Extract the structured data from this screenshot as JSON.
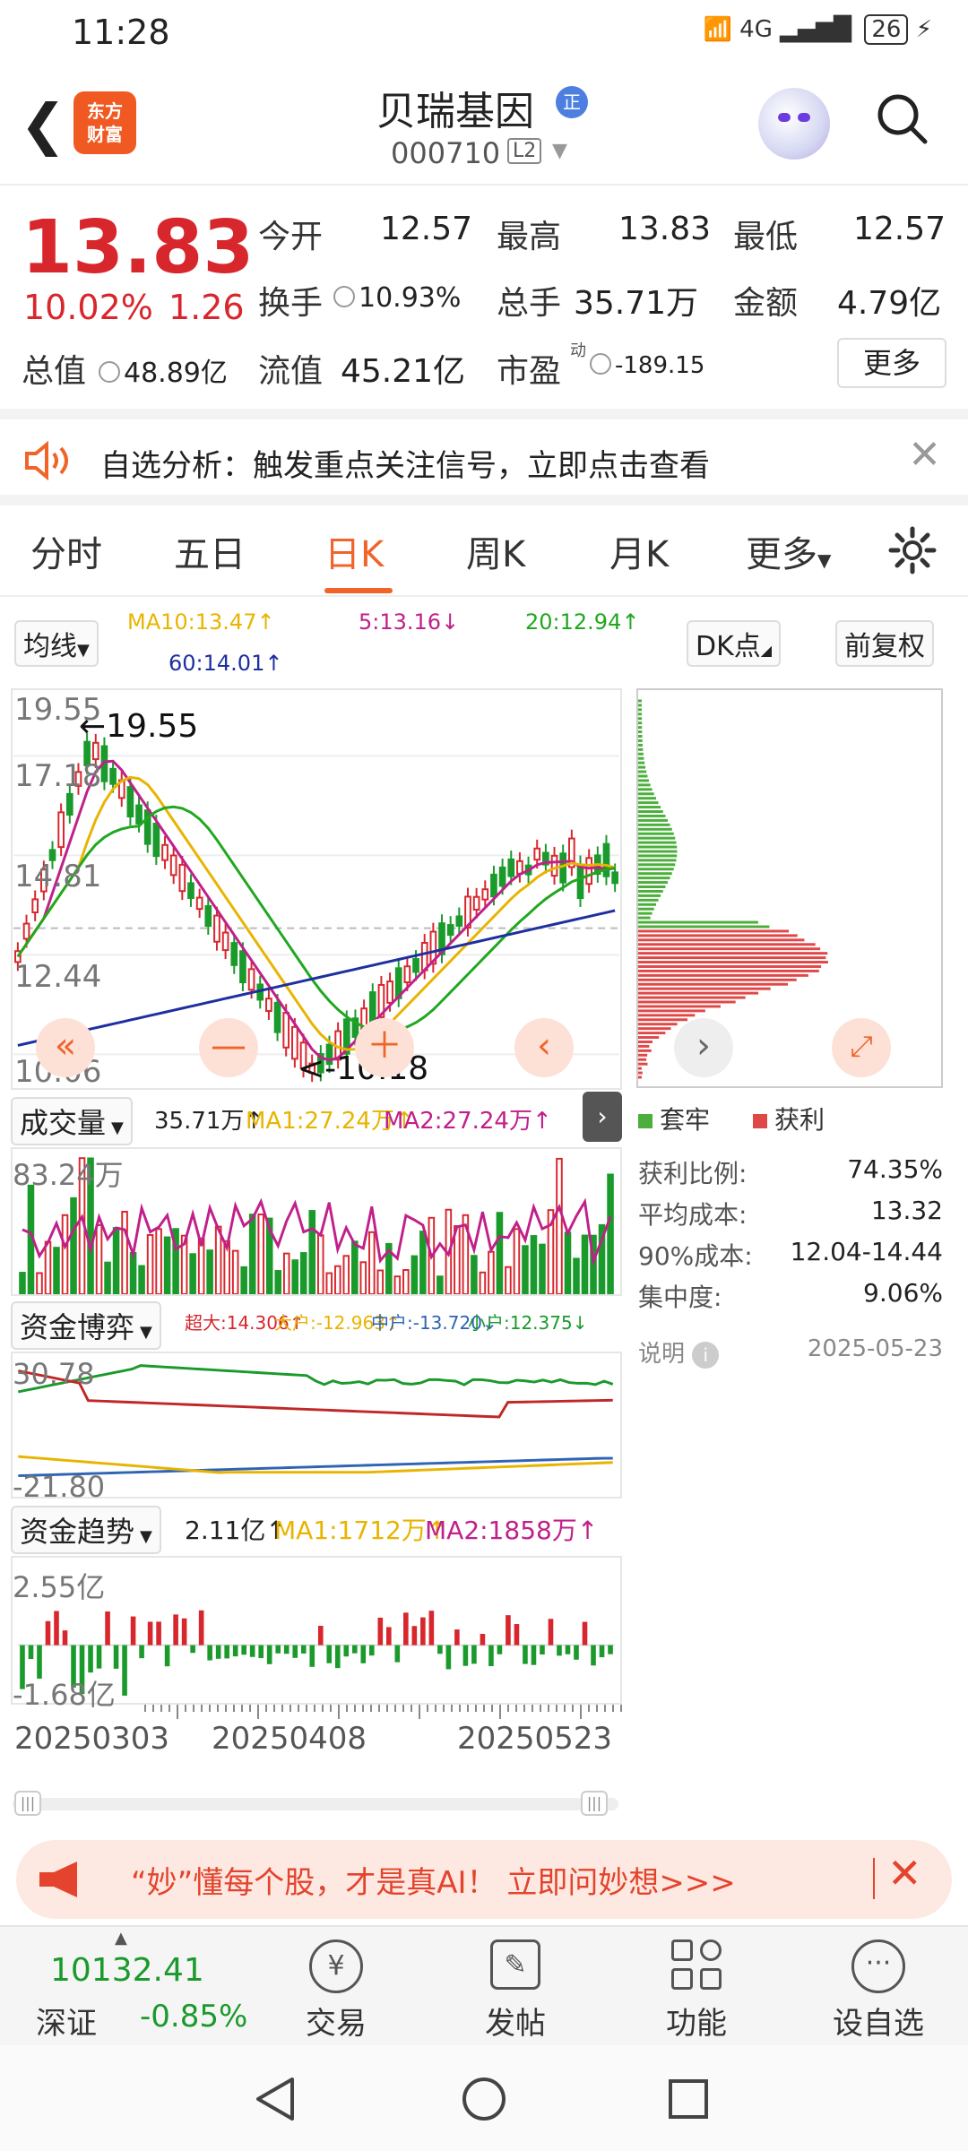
{
  "status_bar": {
    "time": "11:28",
    "network": "4G",
    "battery": "26"
  },
  "header": {
    "title": "贝瑞基因",
    "title_badge": "正",
    "code": "000710",
    "level": "L2",
    "logo_line1": "东方",
    "logo_line2": "财富"
  },
  "quote": {
    "price": "13.83",
    "change_pct": "10.02%",
    "change": "1.26",
    "open_label": "今开",
    "open": "12.57",
    "high_label": "最高",
    "high": "13.83",
    "low_label": "最低",
    "low": "12.57",
    "turnover_label": "换手",
    "turnover": "10.93%",
    "volume_label": "总手",
    "volume": "35.71万",
    "amount_label": "金额",
    "amount": "4.79亿",
    "mktcap_label": "总值",
    "mktcap": "48.89亿",
    "float_label": "流值",
    "float": "45.21亿",
    "pe_label": "市盈",
    "pe_sup": "动",
    "pe": "-189.15",
    "more_label": "更多"
  },
  "notice": {
    "text": "自选分析：触发重点关注信号，立即点击查看"
  },
  "tabs": [
    {
      "label": "分时"
    },
    {
      "label": "五日"
    },
    {
      "label": "日K"
    },
    {
      "label": "周K"
    },
    {
      "label": "月K"
    },
    {
      "label": "更多"
    }
  ],
  "kline": {
    "ma_selector": "均线",
    "ma10": "MA10:13.47↑",
    "ma5": "5:13.16↓",
    "ma20": "20:12.94↑",
    "ma60": "60:14.01↑",
    "dk_label": "DK点",
    "fq_label": "前复权",
    "y_ticks": [
      "19.55",
      "17.18",
      "14.81",
      "12.44",
      "10.06"
    ],
    "max_mark": "←19.55",
    "min_mark": "<-10.18"
  },
  "colors": {
    "accent": "#f0642a",
    "up": "#d8262d",
    "down": "#1b9a2c",
    "ma5": "#c0208a",
    "ma10": "#e8b400",
    "ma20": "#1fa81f",
    "ma60": "#1e2fa0"
  },
  "volume": {
    "selector": "成交量",
    "value": "35.71万↑",
    "ma1": "MA1:27.24万↑",
    "ma2": "MA2:27.24万↑",
    "y_top": "83.24万"
  },
  "fund_game": {
    "selector": "资金博弈",
    "super": "超大:14.306↑",
    "big": "大户:-12.963↑",
    "mid": "中户:-13.720↓",
    "small": "小户:12.375↓",
    "y_top": "30.78",
    "y_bottom": "-21.80"
  },
  "fund_trend": {
    "selector": "资金趋势",
    "value": "2.11亿↑",
    "ma1": "MA1:1712万↑",
    "ma2": "MA2:1858万↑",
    "y_top": "2.55亿",
    "y_bottom": "-1.68亿"
  },
  "dates": [
    "20250303",
    "20250408",
    "20250523"
  ],
  "chip": {
    "legend_trapped": "套牢",
    "legend_profit": "获利",
    "stats": [
      {
        "label": "获利比例:",
        "value": "74.35%"
      },
      {
        "label": "平均成本:",
        "value": "13.32"
      },
      {
        "label": "90%成本:",
        "value": "12.04-14.44"
      },
      {
        "label": "集中度:",
        "value": "9.06%"
      }
    ],
    "note_label": "说明",
    "date": "2025-05-23"
  },
  "ad": {
    "text": "“妙”懂每个股，才是真AI！ 立即问妙想>>>"
  },
  "bottom_nav": {
    "index_value": "10132.41",
    "index_name": "深证",
    "index_change": "-0.85%",
    "items": [
      {
        "label": "交易"
      },
      {
        "label": "发帖"
      },
      {
        "label": "功能"
      },
      {
        "label": "设自选"
      }
    ]
  }
}
